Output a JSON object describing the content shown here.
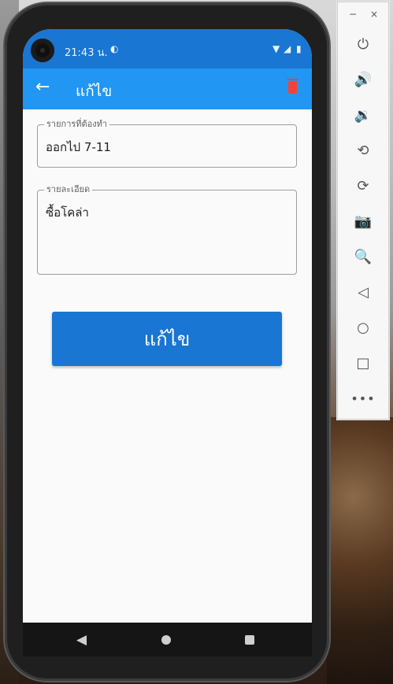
{
  "status_bar": {
    "time": "21:43 น.",
    "status_icons": [
      "p-icon",
      "wifi-icon",
      "signal-icon",
      "battery-icon"
    ]
  },
  "app_bar": {
    "title": "แก้ไข",
    "back_icon": "arrow-left-icon",
    "delete_icon": "trash-icon",
    "delete_color": "#f44336"
  },
  "form": {
    "title_field": {
      "label": "รายการที่ต้องทำ",
      "value": "ออกไป 7-11"
    },
    "detail_field": {
      "label": "รายละเอียด",
      "value": "ซื้อโคล่า"
    },
    "submit_button": {
      "label": "แก้ไข",
      "color": "#1976d2"
    }
  },
  "nav_bar": {
    "back": "triangle-back-icon",
    "home": "circle-home-icon",
    "recent": "square-recent-icon"
  },
  "emulator_panel": {
    "window_controls": [
      "−",
      "×"
    ],
    "tools": [
      "power-icon",
      "volume-up-icon",
      "volume-down-icon",
      "rotate-left-icon",
      "rotate-right-icon",
      "camera-icon",
      "zoom-icon",
      "back-icon",
      "home-icon",
      "overview-icon",
      "more-icon"
    ]
  },
  "colors": {
    "status_bar": "#1976d2",
    "app_bar": "#2196f3",
    "background": "#fafafa"
  }
}
